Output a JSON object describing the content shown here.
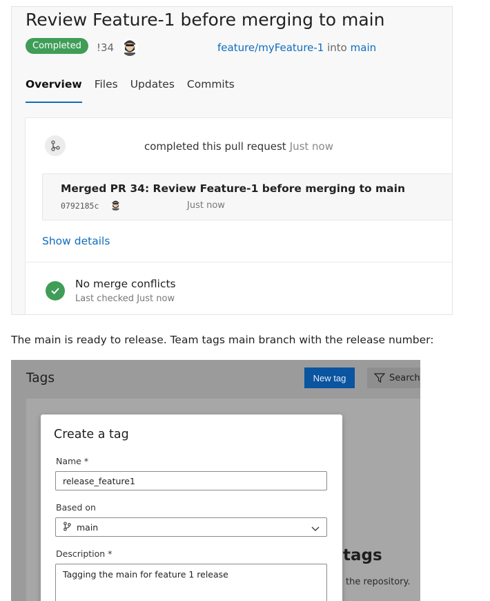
{
  "pull_request": {
    "title": "Review Feature-1 before merging to main",
    "status": "Completed",
    "number": "!34",
    "source_branch": "feature/myFeature-1",
    "into_word": "into",
    "target_branch": "main",
    "tabs": [
      "Overview",
      "Files",
      "Updates",
      "Commits"
    ],
    "active_tab": "Overview",
    "timeline": {
      "event_text": "completed this pull request",
      "event_time": "Just now",
      "merge_title": "Merged PR 34: Review Feature-1 before merging to main",
      "commit_hash": "0792185c",
      "merge_time": "Just now",
      "show_details": "Show details",
      "conflicts_title": "No merge conflicts",
      "conflicts_sub": "Last checked Just now"
    }
  },
  "caption": "The main is ready to release. Team tags main branch with the release number:",
  "tags_page": {
    "header": "Tags",
    "new_tag_label": "New tag",
    "search_placeholder": "Search t",
    "empty_title": "tags",
    "empty_sub": "the repository.",
    "dialog": {
      "title": "Create a tag",
      "name_label": "Name *",
      "name_value": "release_feature1",
      "based_on_label": "Based on",
      "based_on_value": "main",
      "description_label": "Description *",
      "description_value": "Tagging the main for feature 1 release"
    }
  },
  "colors": {
    "accent": "#0f6cbd",
    "success": "#3f9d57",
    "primary_button": "#0a54a0"
  }
}
